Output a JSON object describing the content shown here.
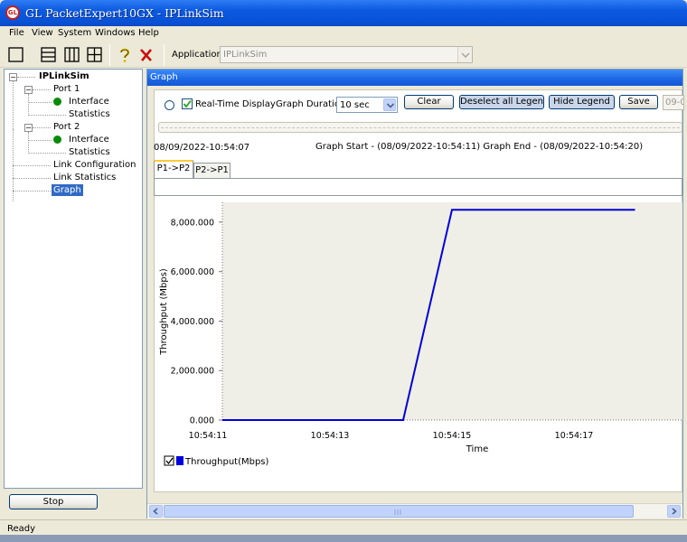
{
  "window": {
    "title": "GL PacketExpert10GX - IPLinkSim",
    "app_icon_text": "GL"
  },
  "menu": [
    "File",
    "View",
    "System",
    "Windows",
    "Help"
  ],
  "toolbar": {
    "application_label": "Application:",
    "application_value": "IPLinkSim",
    "icons": [
      "single-view-icon",
      "horizontal-split-icon",
      "vertical-split-icon",
      "quad-view-icon",
      "help-icon",
      "close-icon"
    ]
  },
  "tree": {
    "root": "IPLinkSim",
    "port1": "Port 1",
    "port1_interface": "Interface",
    "port1_statistics": "Statistics",
    "port2": "Port 2",
    "port2_interface": "Interface",
    "port2_statistics": "Statistics",
    "link_configuration": "Link Configuration",
    "link_statistics": "Link Statistics",
    "graph": "Graph",
    "status_dot_color": "#0a8a0a"
  },
  "stop_button": "Stop",
  "panel": {
    "header": "Graph",
    "realtime_label": "Real-Time Display",
    "duration_label": "Graph Duration",
    "duration_value": "10 sec",
    "clear_button": "Clear",
    "deselect_button": "Deselect all Legends",
    "hide_legend_button": "Hide Legend",
    "save_button": "Save",
    "extra_field": "09-0",
    "current_time": "08/09/2022-10:54:07",
    "range_text": "Graph Start - (08/09/2022-10:54:11) Graph End - (08/09/2022-10:54:20)",
    "tabs": [
      "P1->P2",
      "P2->P1"
    ]
  },
  "chart_data": {
    "type": "line",
    "xlabel": "Time",
    "ylabel": "Throughput (Mbps)",
    "x_ticks": [
      "10:54:11",
      "10:54:13",
      "10:54:15",
      "10:54:17"
    ],
    "y_ticks": [
      "0.000",
      "2,000.000",
      "4,000.000",
      "6,000.000",
      "8,000.000"
    ],
    "ylim": [
      0,
      8800
    ],
    "x_unit": "seconds",
    "series": [
      {
        "name": "Throughput(Mbps)",
        "color": "#0000dd",
        "x": [
          "10:54:11",
          "10:54:14.2",
          "10:54:15",
          "10:54:18"
        ],
        "y": [
          0,
          0,
          8500,
          8500
        ]
      }
    ],
    "legend": "bottom-left",
    "background": "#efefe7",
    "grid": false
  },
  "status": "Ready"
}
